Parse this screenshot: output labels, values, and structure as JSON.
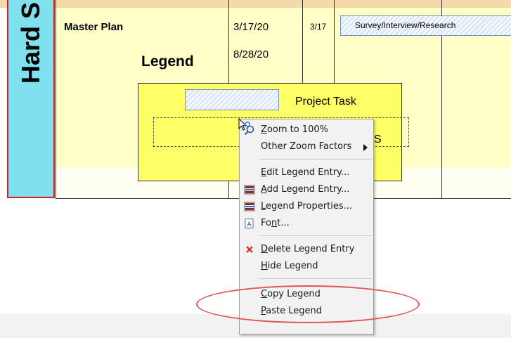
{
  "side_label": "Hard S",
  "row": {
    "name": "Master Plan",
    "start_date": "3/17/20",
    "finish_date": "8/28/20",
    "bar_date": "3/17",
    "bar_label": "Survey/Interview/Research"
  },
  "legend": {
    "heading": "Legend",
    "task_label": "Project Task",
    "partial_text": "S"
  },
  "context_menu": {
    "items": [
      {
        "label": "Zoom to 100%",
        "mnemonic": "Z",
        "icon": "zoom-icon"
      },
      {
        "label": "Other Zoom Factors",
        "mnemonic": "",
        "icon": "none",
        "submenu": true
      },
      {
        "label": "Edit Legend Entry...",
        "mnemonic": "E",
        "icon": "none"
      },
      {
        "label": "Add Legend Entry...",
        "mnemonic": "A",
        "icon": "legend-table-icon"
      },
      {
        "label": "Legend Properties...",
        "mnemonic": "L",
        "icon": "legend-table-icon"
      },
      {
        "label": "Font...",
        "mnemonic": "n",
        "icon": "font-icon"
      },
      {
        "label": "Delete Legend Entry",
        "mnemonic": "D",
        "icon": "delete-x-icon"
      },
      {
        "label": "Hide Legend",
        "mnemonic": "H",
        "icon": "none"
      },
      {
        "label": "Copy Legend",
        "mnemonic": "C",
        "icon": "none"
      },
      {
        "label": "Paste Legend",
        "mnemonic": "P",
        "icon": "none"
      }
    ]
  },
  "colors": {
    "side_label_bg": "#7fe1ee",
    "side_label_border": "#e01818",
    "chart_bg": "#ffffc8",
    "legend_bg": "#ffff66",
    "highlight": "#e05555",
    "delete_icon": "#d9382a"
  }
}
